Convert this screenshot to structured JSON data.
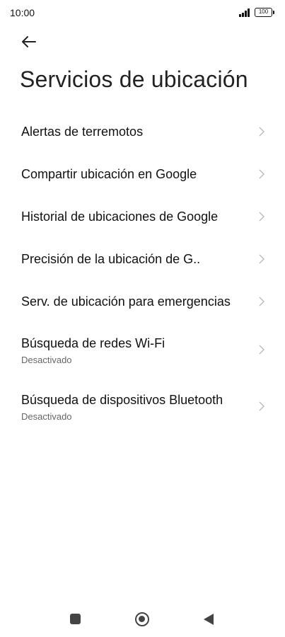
{
  "status_bar": {
    "time": "10:00",
    "battery": "100"
  },
  "header": {
    "back_icon": "back-arrow-icon",
    "title": "Servicios de ubicación"
  },
  "items": [
    {
      "label": "Alertas de terremotos",
      "sub": ""
    },
    {
      "label": "Compartir ubicación en Google",
      "sub": ""
    },
    {
      "label": "Historial de ubicaciones de Google",
      "sub": ""
    },
    {
      "label": "Precisión de la ubicación de G..",
      "sub": ""
    },
    {
      "label": "Serv. de ubicación para emergencias",
      "sub": ""
    },
    {
      "label": "Búsqueda de redes Wi-Fi",
      "sub": "Desactivado"
    },
    {
      "label": "Búsqueda de dispositivos Bluetooth",
      "sub": "Desactivado"
    }
  ],
  "nav_bar": {
    "recents_icon": "square-recents-icon",
    "home_icon": "circle-home-icon",
    "back_icon": "triangle-back-icon"
  },
  "colors": {
    "background": "#ffffff",
    "text_primary": "#111111",
    "text_secondary": "#666666",
    "chevron": "#bbbbbb"
  }
}
